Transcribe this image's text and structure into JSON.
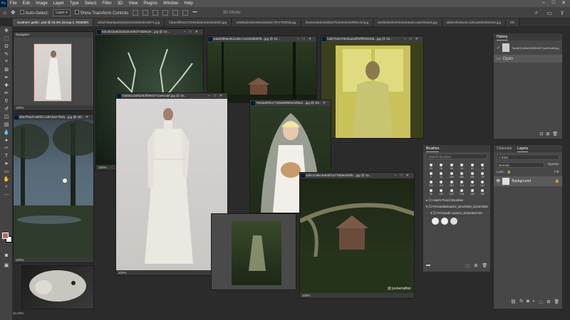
{
  "app": {
    "menu": [
      "File",
      "Edit",
      "Image",
      "Layer",
      "Type",
      "Select",
      "Filter",
      "3D",
      "View",
      "Plugins",
      "Window",
      "Help"
    ]
  },
  "options": {
    "auto_select_label": "Auto-Select:",
    "auto_select_value": "Layer",
    "transform_label": "Show Transform Controls",
    "three_d_label": "3D Mode:"
  },
  "tabs": [
    "Southern gothic .psd @ 33.3% (Group 1, RGB/8#)",
    "8d3d7da505ad4bda404d4b6b5d4c6571.jpg",
    "f45ac6ff5e6472004dd4b4de5d5684b.jpg",
    "12896ab04b48d61b0bd6c797e7f39f3d.jpg",
    "3b44e4afa043ddbd7f13e0e5e000f9e14d.jpg",
    "6b6fd25e0b4f40454b5a91c48ef49a09.jpg",
    "d6d3c0b45e4ec1d61a8d0e88cbe8.jpg",
    "fd4"
  ],
  "windows": {
    "navigator": {
      "title": "Navigator",
      "zoom": "100%"
    },
    "tree": {
      "title": "bdc4b1ba8d423a3e4d0d7c5bb63e...jpg @ 10...",
      "zoom": "100%"
    },
    "swamp_house": {
      "title": "4da629b6ed51a46cc1a01b9b80f5...jpg @ 10...",
      "zoom": "100%"
    },
    "yellow_window": {
      "title": "fa4b75257092ba2a0f59ff0f494d5...jpg @ 10...",
      "zoom": "100%"
    },
    "moss_trees": {
      "title": "8b97f0ad7e6f6f4c1d0cb6e7f5d1...jpg @ 10...",
      "zoom": "100%"
    },
    "main_dress": {
      "title": "7aeb612a0fa263f0fe0271ae91abf.jpg @ 10...",
      "zoom": "100%"
    },
    "puppy_bride": {
      "title": "760da6f6b4c73d6a8d6b6e6d9a2...jpg @ 10...",
      "zoom": "100%"
    },
    "old_house": {
      "title": "4d9c1c8bc4e6d2f1a77bb9e3d4f0...jpg @ 10...",
      "zoom": "100%",
      "watermark": "@ jusnerrathor"
    },
    "sheep": {
      "zoom": "100%"
    },
    "doc_status": "33.33%"
  },
  "history": {
    "title": "History",
    "snapshot_name": "7aeb612a0fa263f0fe0271ae91abf.jpg",
    "open_label": "Open"
  },
  "layers": {
    "tab_channels": "Channels",
    "tab_layers": "Layers",
    "kind_label": "Kind",
    "blend_mode": "Normal",
    "opacity_label": "Opacity:",
    "lock_label": "Lock:",
    "fill_label": "Fill:",
    "background_layer": "Background"
  },
  "brushes": {
    "title": "Brushes",
    "search_placeholder": "Search Brushes",
    "sizes": [
      "15",
      "25",
      "36",
      "14",
      "60",
      "18",
      "9",
      "14",
      "100",
      "260",
      "200",
      "78",
      "242",
      "192",
      "263",
      "214",
      "204",
      "242",
      "55",
      "142",
      "242",
      "215",
      "158",
      "155"
    ],
    "folder_1": "Hatch Pencil Brushes",
    "folder_2": "FernandaSuarez_BrushSet_Essentials",
    "folder_3": "Fernanda Suarez_Essential Set",
    "sub_sizes": [
      "200",
      "400",
      "300",
      "300",
      "300",
      "200",
      "300",
      "500",
      "300"
    ]
  },
  "colors": {
    "ui_bg": "#2b2b2b",
    "panel": "#474747",
    "foreground_swatch": "#b5685a",
    "background_swatch": "#ffffff"
  }
}
